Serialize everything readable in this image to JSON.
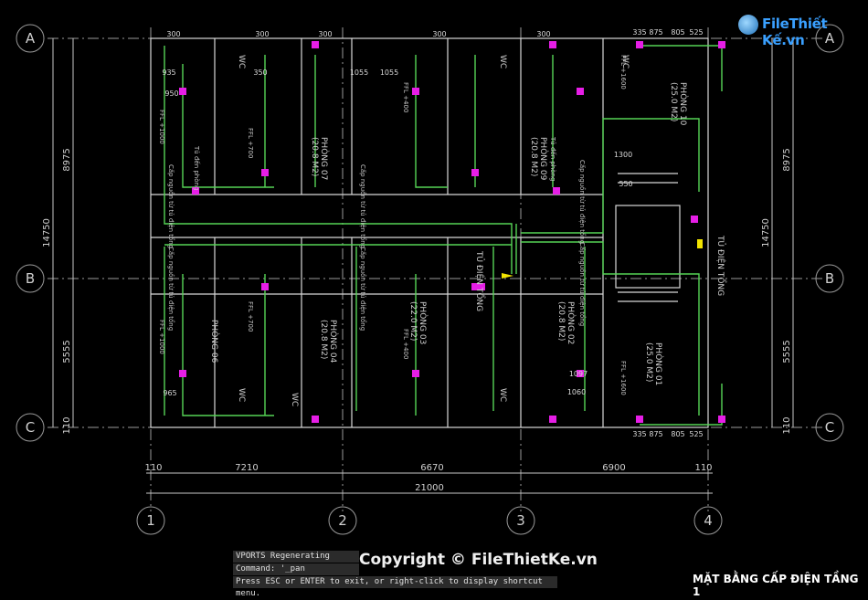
{
  "brand": {
    "logo_text": "FileThiết Kế.vn",
    "watermark": "Copyright © FileThietKe.vn"
  },
  "command_line": {
    "line1": "VPORTS Regenerating model.",
    "line2": "Command: '_pan",
    "line3": "Press ESC or ENTER to exit, or right-click to display shortcut menu."
  },
  "sheet_title": "MẶT BẰNG CẤP ĐIỆN TẦNG 1",
  "grid": {
    "rows": [
      "A",
      "B",
      "C"
    ],
    "cols": [
      "1",
      "2",
      "3",
      "4"
    ],
    "left_dims": [
      "8975",
      "14750",
      "5555",
      "110"
    ],
    "right_dims": [
      "8975",
      "14750",
      "5555",
      "110"
    ],
    "bottom_dims": [
      "110",
      "7210",
      "6670",
      "6900",
      "110"
    ],
    "total_width": "21000"
  },
  "rooms": [
    {
      "name": "PHÒNG 07",
      "area": "(20.8 M2)"
    },
    {
      "name": "PHÒNG 08",
      "area": "(22.0 M2)"
    },
    {
      "name": "PHÒNG 09",
      "area": "(20.8 M2)"
    },
    {
      "name": "PHÒNG 10",
      "area": "(25.0 M2)"
    },
    {
      "name": "PHÒNG 06",
      "area": "(20.8 M2)"
    },
    {
      "name": "PHÒNG 04",
      "area": "(20.8 M2)"
    },
    {
      "name": "PHÒNG 03",
      "area": "(22.0 M2)"
    },
    {
      "name": "PHÒNG 02",
      "area": "(20.8 M2)"
    },
    {
      "name": "PHÒNG 01",
      "area": "(25.0 M2)"
    }
  ],
  "labels": {
    "wc": "WC",
    "panel": "TỦ ĐIỆN TỔNG",
    "feed": "Cấp nguồn từ tủ điện tổng",
    "to_room": "Tủ đến phòng",
    "dims": [
      "300",
      "935",
      "950",
      "1055",
      "350",
      "550",
      "1300",
      "335",
      "875",
      "805",
      "525",
      "965",
      "1060",
      "1097"
    ],
    "ffl": [
      "FFL +1000",
      "FFL +700",
      "FFL +400",
      "FFL +1600"
    ]
  },
  "colors": {
    "wall": "#d8d8d8",
    "wire": "#55d455",
    "device": "#e61ee6",
    "dim": "#c8c8c8",
    "panel": "#f2e400",
    "axis": "#9a9a9a"
  }
}
